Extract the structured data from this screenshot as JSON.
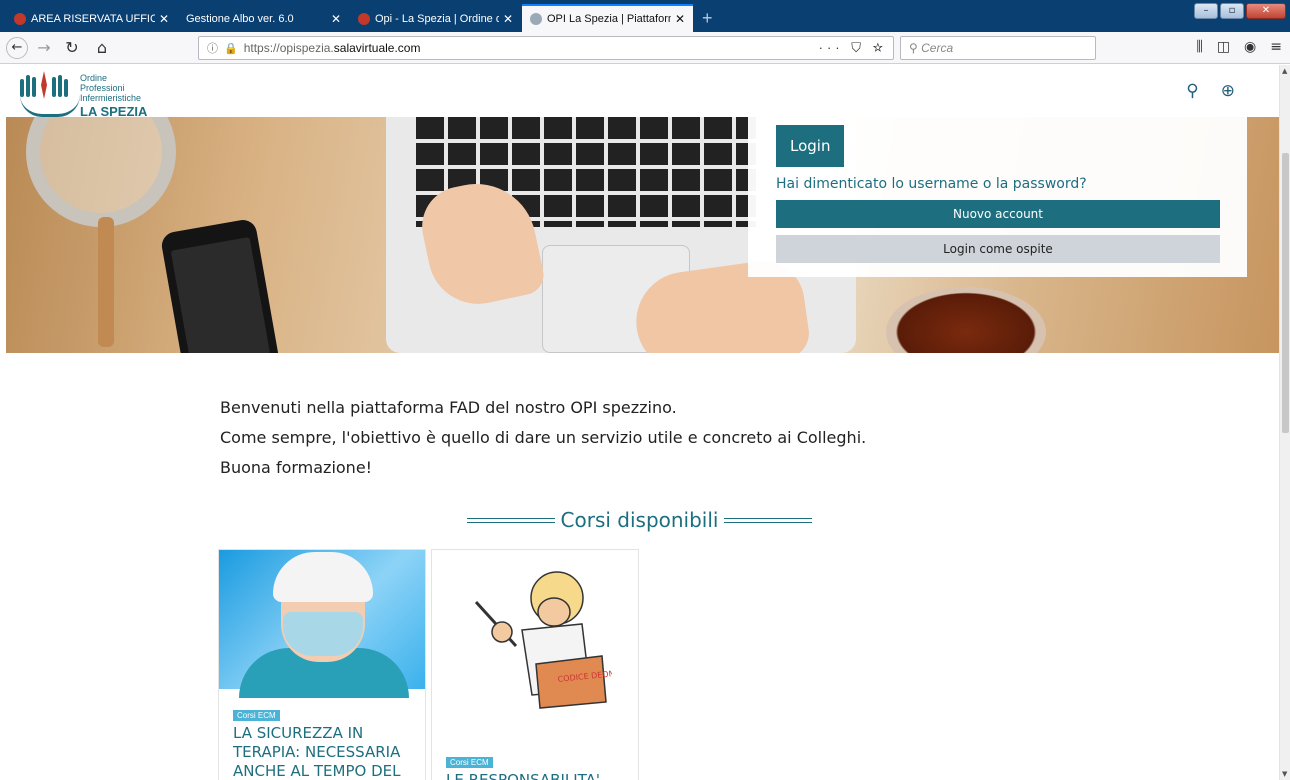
{
  "browser": {
    "tabs": [
      {
        "title": "AREA RISERVATA UFFICI - fnopi",
        "active": false
      },
      {
        "title": "Gestione Albo ver. 6.0",
        "active": false
      },
      {
        "title": "Opi - La Spezia | Ordine delle pr",
        "active": false
      },
      {
        "title": "OPI La Spezia | Piattaforma FaD",
        "active": true
      }
    ],
    "new_tab": "+",
    "url_prefix": "https://opispezia.",
    "url_domain": "salavirtuale.com",
    "url_actions": "··· ⛉ ☆",
    "search_placeholder": "Cerca"
  },
  "site": {
    "logo_line1": "Ordine",
    "logo_line2": "Professioni",
    "logo_line3": "Infermieristiche",
    "logo_city": "LA SPEZIA",
    "accent": "#1d6f80",
    "icons": [
      "search-icon",
      "language-globe-icon"
    ]
  },
  "login": {
    "title": "Login",
    "forgot": "Hai dimenticato lo username o la password?",
    "new_account": "Nuovo account",
    "guest": "Login come ospite"
  },
  "welcome": {
    "line1": "Benvenuti nella piattaforma FAD del nostro OPI spezzino.",
    "line2": "Come sempre, l'obiettivo è quello di dare un servizio utile e concreto ai Colleghi.",
    "line3": "Buona formazione!"
  },
  "courses": {
    "section_title": "Corsi disponibili",
    "items": [
      {
        "badge": "Corsi ECM",
        "title": "LA SICUREZZA IN TERAPIA: NECESSARIA ANCHE AL TEMPO DEL"
      },
      {
        "badge": "Corsi ECM",
        "title": "LE RESPONSABILITA'",
        "image_text": "CODICE DEONTOLOGICO"
      }
    ]
  }
}
